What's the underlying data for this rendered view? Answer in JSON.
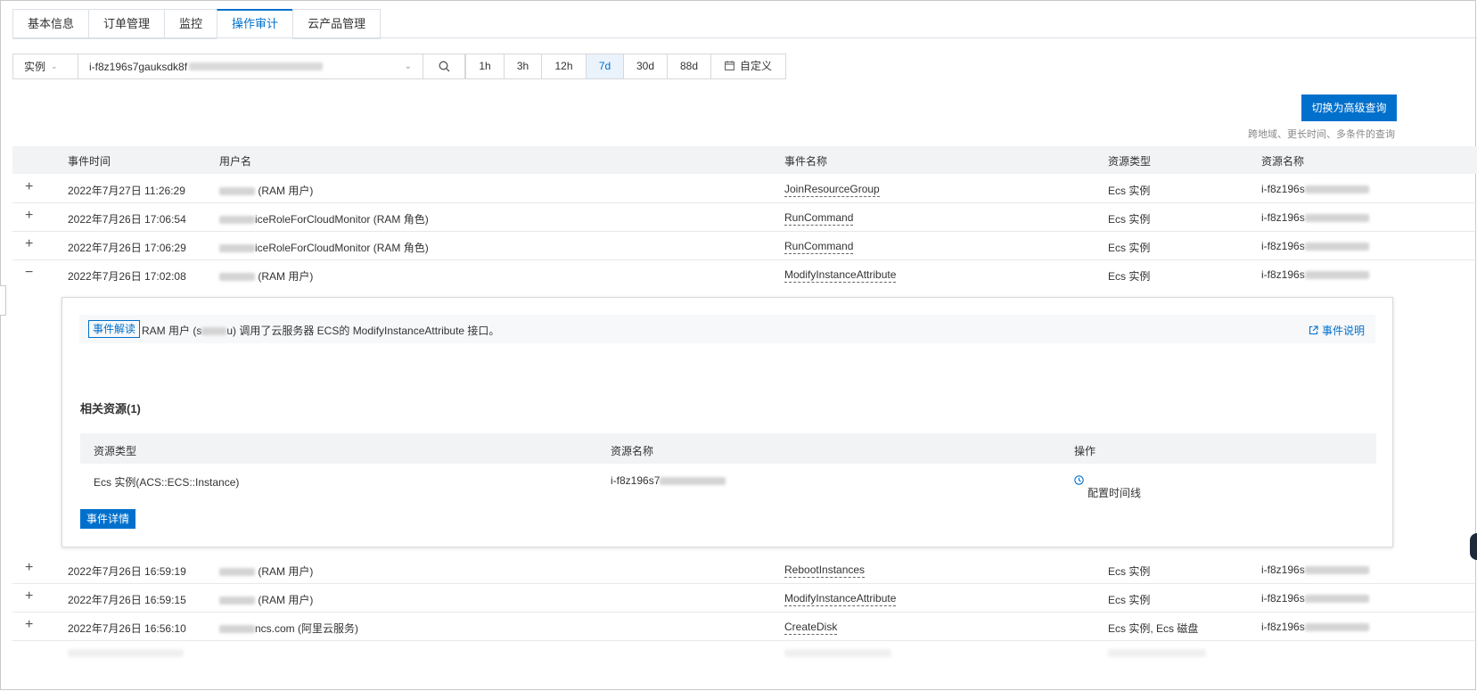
{
  "tabs": [
    {
      "label": "基本信息"
    },
    {
      "label": "订单管理"
    },
    {
      "label": "监控"
    },
    {
      "label": "操作审计"
    },
    {
      "label": "云产品管理"
    }
  ],
  "search": {
    "type_label": "实例",
    "instance_value": "i-f8z196s7gauksdk8f"
  },
  "time_ranges": [
    {
      "label": "1h"
    },
    {
      "label": "3h"
    },
    {
      "label": "12h"
    },
    {
      "label": "7d"
    },
    {
      "label": "30d"
    },
    {
      "label": "88d"
    },
    {
      "label": "自定义"
    }
  ],
  "advanced": {
    "button": "切换为高级查询",
    "hint": "跨地域、更长时间、多条件的查询"
  },
  "table": {
    "headers": {
      "time": "事件时间",
      "user": "用户名",
      "event": "事件名称",
      "rtype": "资源类型",
      "rname": "资源名称"
    },
    "rows": [
      {
        "expand": "+",
        "time": "2022年7月27日 11:26:29",
        "user": "(RAM 用户)",
        "event": "JoinResourceGroup",
        "rtype": "Ecs 实例",
        "rname": "i-f8z196s"
      },
      {
        "expand": "+",
        "time": "2022年7月26日 17:06:54",
        "user": "iceRoleForCloudMonitor (RAM 角色)",
        "event": "RunCommand",
        "rtype": "Ecs 实例",
        "rname": "i-f8z196s"
      },
      {
        "expand": "+",
        "time": "2022年7月26日 17:06:29",
        "user": "iceRoleForCloudMonitor (RAM 角色)",
        "event": "RunCommand",
        "rtype": "Ecs 实例",
        "rname": "i-f8z196s"
      },
      {
        "expand": "−",
        "time": "2022年7月26日 17:02:08",
        "user": "(RAM 用户)",
        "event": "ModifyInstanceAttribute",
        "rtype": "Ecs 实例",
        "rname": "i-f8z196s"
      },
      {
        "expand": "+",
        "time": "2022年7月26日 16:59:19",
        "user": "(RAM 用户)",
        "event": "RebootInstances",
        "rtype": "Ecs 实例",
        "rname": "i-f8z196s"
      },
      {
        "expand": "+",
        "time": "2022年7月26日 16:59:15",
        "user": "(RAM 用户)",
        "event": "ModifyInstanceAttribute",
        "rtype": "Ecs 实例",
        "rname": "i-f8z196s"
      },
      {
        "expand": "+",
        "time": "2022年7月26日 16:56:10",
        "user": "ncs.com (阿里云服务)",
        "event": "CreateDisk",
        "rtype": "Ecs 实例, Ecs 磁盘",
        "rname": "i-f8z196s"
      }
    ]
  },
  "detail": {
    "tag": "事件解读",
    "text_prefix": "RAM 用户 (s",
    "text_suffix": "u) 调用了云服务器 ECS的 ModifyInstanceAttribute 接口。",
    "explain_link": "事件说明",
    "related_title": "相关资源(1)",
    "related_headers": {
      "type": "资源类型",
      "name": "资源名称",
      "op": "操作"
    },
    "related_row": {
      "type": "Ecs 实例(ACS::ECS::Instance)",
      "name": "i-f8z196s7",
      "op": "配置时间线"
    },
    "detail_button": "事件详情"
  }
}
